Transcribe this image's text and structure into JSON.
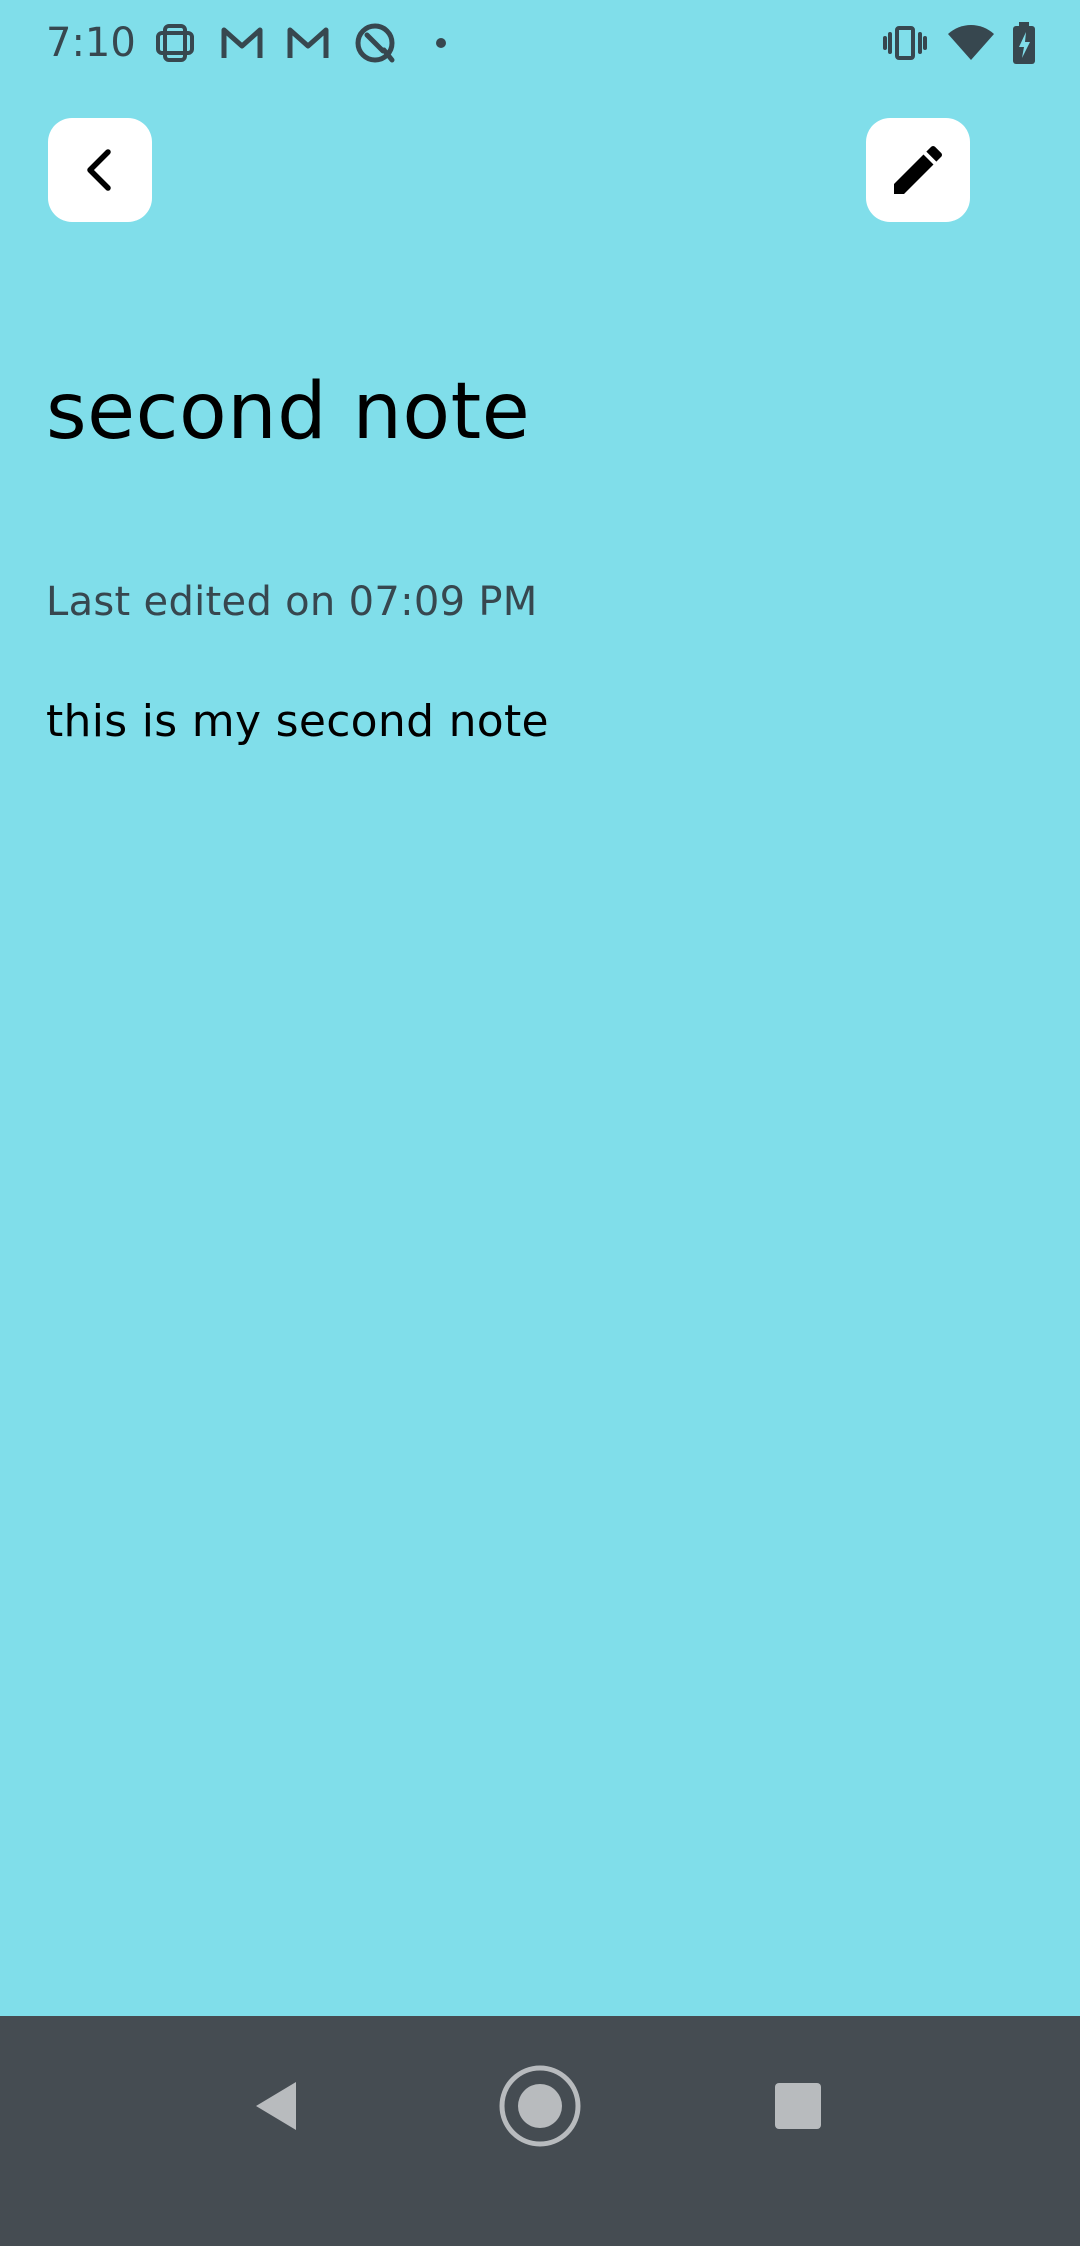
{
  "colors": {
    "background": "#80DEEA",
    "status_foreground": "#37474F",
    "button_background": "#FFFFFF",
    "icon": "#000000",
    "title_text": "#000000",
    "meta_text": "#37474F",
    "body_text": "#000000",
    "nav_background": "#454C52",
    "nav_icon": "#B8BBBE"
  },
  "status_bar": {
    "time": "7:10",
    "left_icons": [
      "grid-notification-icon",
      "gmail-icon",
      "gmail-icon",
      "data-saver-icon",
      "dot-icon"
    ],
    "right_icons": [
      "vibrate-icon",
      "wifi-icon",
      "battery-charging-icon"
    ]
  },
  "toolbar": {
    "back_icon": "chevron-left-icon",
    "edit_icon": "pencil-icon"
  },
  "note": {
    "title": "second note",
    "meta": "Last edited on 07:09 PM",
    "body": "this is my second note"
  },
  "nav_bar": {
    "back": "triangle-back-icon",
    "home": "circle-home-icon",
    "recents": "square-recents-icon"
  }
}
